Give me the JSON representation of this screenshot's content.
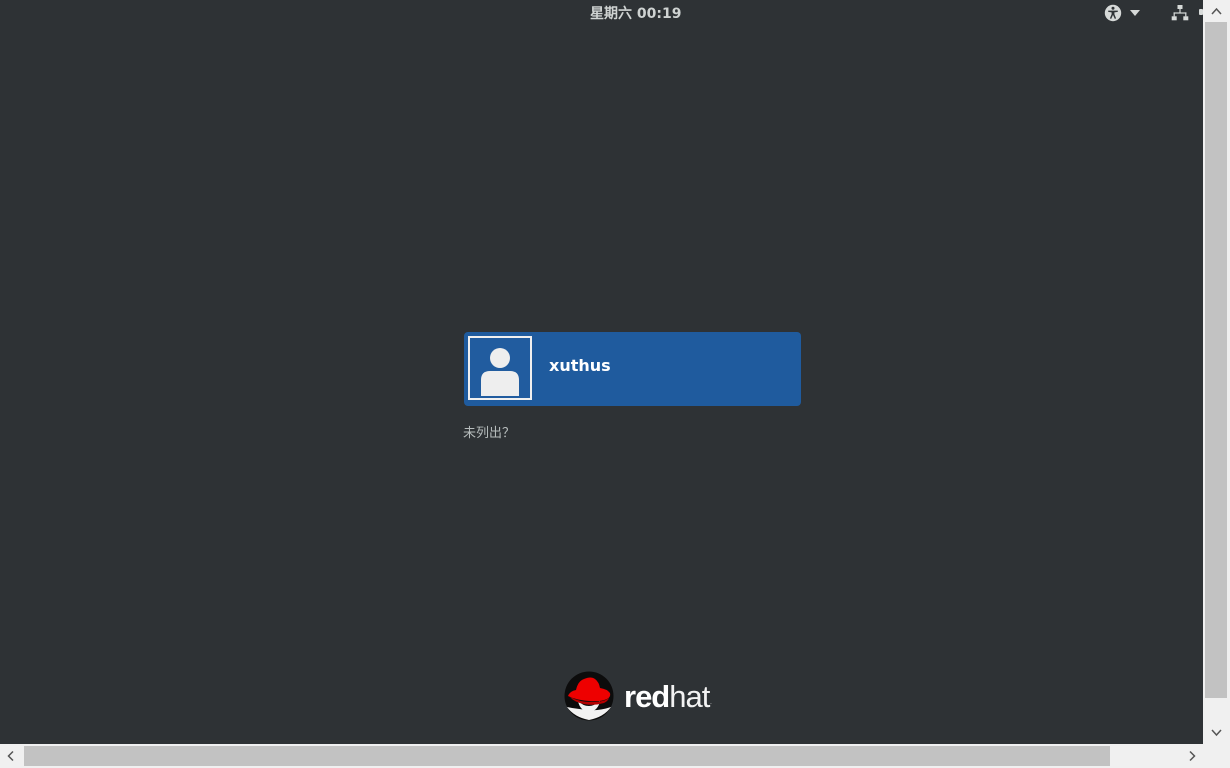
{
  "top_bar": {
    "clock": "星期六 00:19",
    "accessibility_icon": "accessibility-icon",
    "menu_arrow_icon": "chevron-down-icon",
    "network_icon": "network-wired-icon"
  },
  "user_list": {
    "users": [
      {
        "name": "xuthus",
        "avatar_icon": "user-avatar-icon"
      }
    ],
    "not_listed": "未列出？"
  },
  "branding": {
    "logo_icon": "redhat-shadowman-logo",
    "logo_text_bold": "red",
    "logo_text_thin": "hat",
    "logo_trademark": "."
  },
  "colors": {
    "background": "#2e3235",
    "selected_user": "#1f5b9e",
    "text_primary": "#ffffff",
    "text_muted": "#b6bcbc",
    "brand_red": "#ee0000"
  }
}
